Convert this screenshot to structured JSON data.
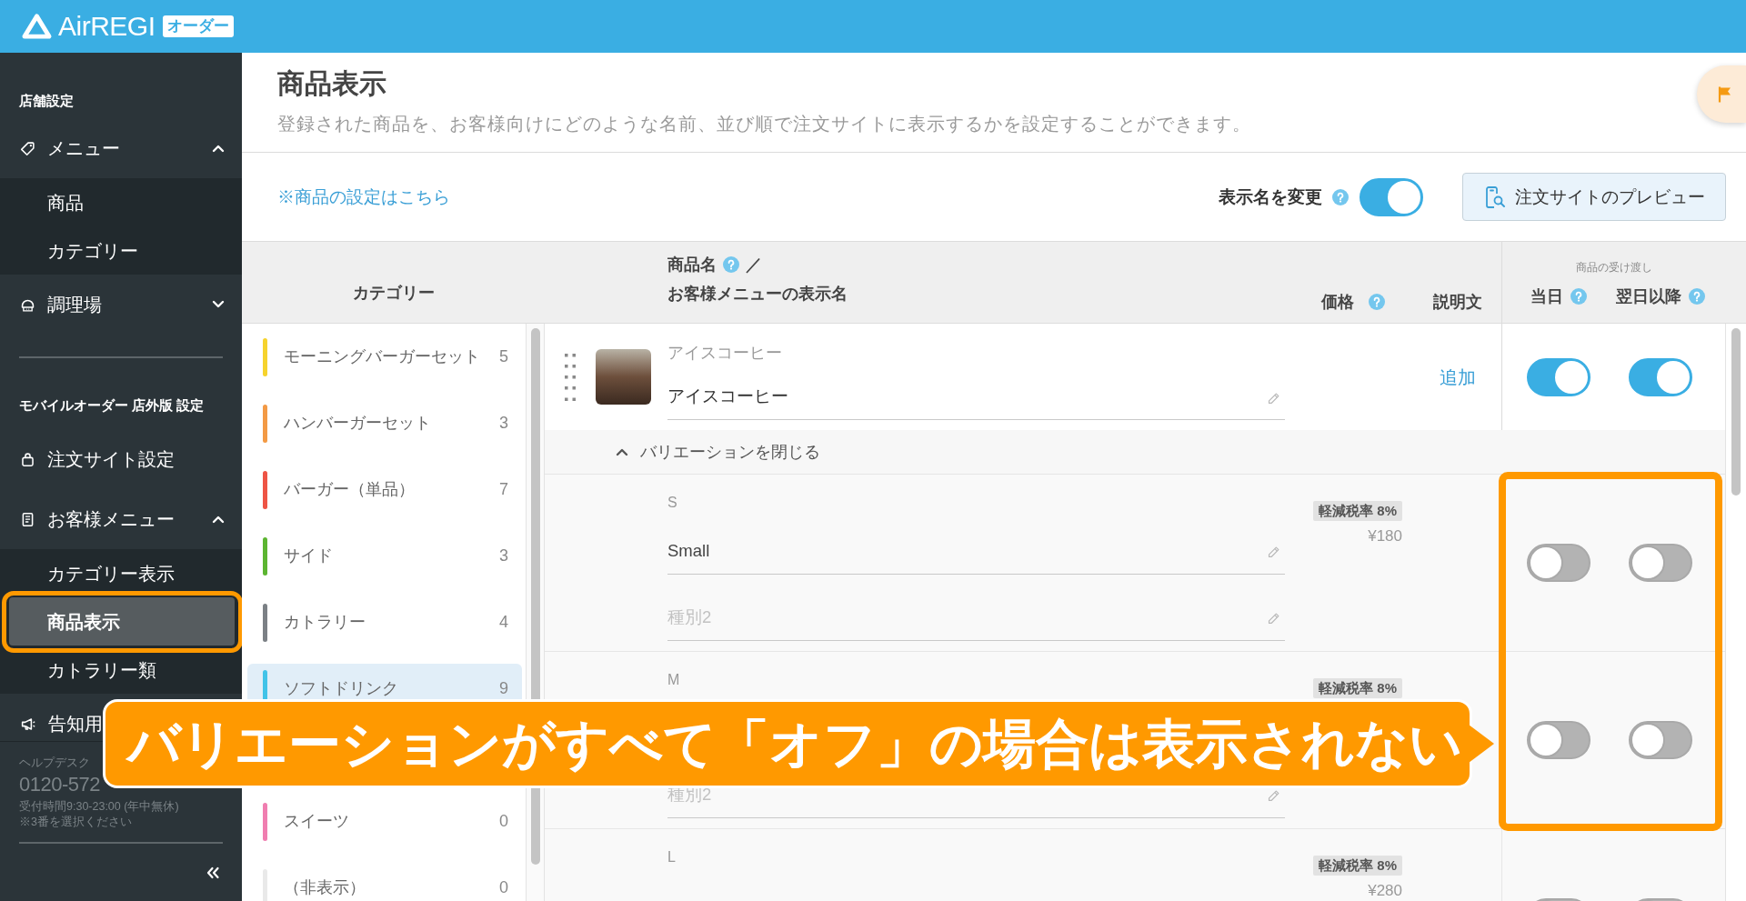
{
  "header": {
    "logo_text": "AirREGI",
    "logo_badge": "オーダー"
  },
  "sidebar": {
    "sections": [
      {
        "title": "店舗設定",
        "items": [
          {
            "label": "メニュー",
            "expanded": true,
            "children": [
              {
                "label": "商品",
                "selected": false,
                "highlighted": false
              },
              {
                "label": "カテゴリー",
                "selected": false,
                "highlighted": false
              }
            ]
          },
          {
            "label": "調理場",
            "expanded": false
          }
        ]
      },
      {
        "title": "モバイルオーダー 店外版 設定",
        "items": [
          {
            "label": "注文サイト設定"
          },
          {
            "label": "お客様メニュー",
            "expanded": true,
            "children": [
              {
                "label": "カテゴリー表示",
                "selected": false,
                "highlighted": false
              },
              {
                "label": "商品表示",
                "selected": true,
                "highlighted": true
              },
              {
                "label": "カトラリー類",
                "selected": false,
                "highlighted": false
              }
            ]
          },
          {
            "label": "告知用"
          }
        ]
      }
    ],
    "helpdesk": {
      "label": "ヘルプデスク",
      "phone": "0120-572",
      "hours": "受付時間9:30-23:00 (年中無休)",
      "note": "※3番を選択ください"
    }
  },
  "page": {
    "title": "商品表示",
    "description": "登録された商品を、お客様向けにどのような名前、並び順で注文サイトに表示するかを設定することができます。"
  },
  "toolbar": {
    "settings_link": "※商品の設定はこちら",
    "display_name_switch": {
      "label": "表示名を変更",
      "on": true
    },
    "preview_button": "注文サイトのプレビュー"
  },
  "table": {
    "columns": {
      "category": "カテゴリー",
      "name": "商品名",
      "name_separator": "／",
      "display_name": "お客様メニューの表示名",
      "price": "価格",
      "description": "説明文",
      "delivery": "商品の受け渡し",
      "same_day": "当日",
      "next_day": "翌日以降"
    }
  },
  "categories": [
    {
      "name": "モーニングバーガーセット",
      "count": "5",
      "color": "#f6d32d",
      "selected": false
    },
    {
      "name": "ハンバーガーセット",
      "count": "3",
      "color": "#f39a45",
      "selected": false
    },
    {
      "name": "バーガー（単品）",
      "count": "7",
      "color": "#ee5445",
      "selected": false
    },
    {
      "name": "サイド",
      "count": "3",
      "color": "#5cb531",
      "selected": false
    },
    {
      "name": "カトラリー",
      "count": "4",
      "color": "#7b8085",
      "selected": false
    },
    {
      "name": "ソフトドリンク",
      "count": "9",
      "color": "#41c3e8",
      "selected": true
    },
    {
      "name": "スイーツ",
      "count": "0",
      "color": "#f07eb0",
      "selected": false
    },
    {
      "name": "（非表示）",
      "count": "0",
      "color": "#e9e9e9",
      "selected": false
    }
  ],
  "products": [
    {
      "original_name": "アイスコーヒー",
      "display_name": "アイスコーヒー",
      "description_action": "追加",
      "same_day": true,
      "next_day": true,
      "variations_expanded": true,
      "variations_toggle_label": "バリエーションを閉じる",
      "variations": [
        {
          "label": "S",
          "display_name": "Small",
          "type2_placeholder": "種別2",
          "tax_badge": "軽減税率 8%",
          "price": "¥180",
          "same_day": false,
          "next_day": false,
          "highlighted": true
        },
        {
          "label": "M",
          "type2_placeholder": "種別2",
          "tax_badge": "軽減税率 8%",
          "same_day": false,
          "next_day": false,
          "highlighted": true
        },
        {
          "label": "L",
          "tax_badge": "軽減税率 8%",
          "price": "¥280",
          "same_day": false,
          "next_day": false,
          "highlighted": false
        }
      ]
    }
  ],
  "annotation": {
    "callout_text": "バリエーションがすべて「オフ」の場合は表示されない"
  }
}
